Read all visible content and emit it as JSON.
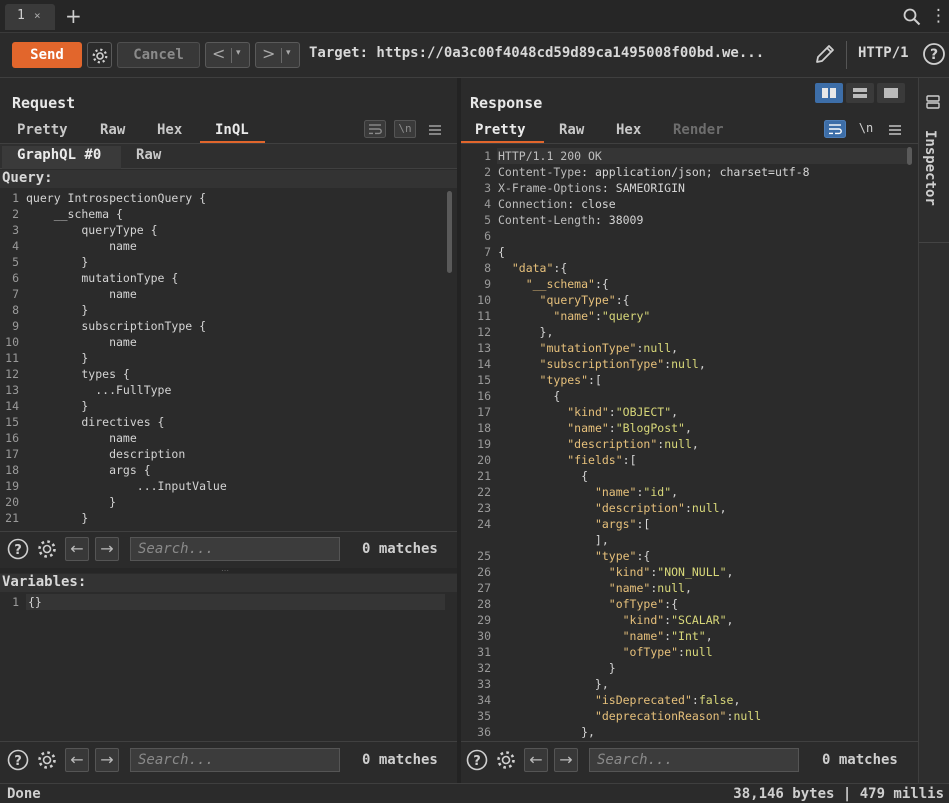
{
  "tabbar": {
    "tab_label": "1",
    "close": "×",
    "add": "+"
  },
  "toolbar": {
    "send_label": "Send",
    "cancel_label": "Cancel",
    "back_arrow": "<",
    "forward_arrow": ">",
    "dropdown": "▾",
    "target": "Target: https://0a3c00f4048cd59d89ca1495008f00bd.we...",
    "http_version": "HTTP/1"
  },
  "request": {
    "title": "Request",
    "tabs": [
      "Pretty",
      "Raw",
      "Hex",
      "InQL"
    ],
    "active_tab": "InQL",
    "inql_tabs": [
      "GraphQL #0",
      "Raw"
    ],
    "query_label": "Query:",
    "query_lines": [
      "query IntrospectionQuery {",
      "    __schema {",
      "        queryType {",
      "            name",
      "        }",
      "        mutationType {",
      "            name",
      "        }",
      "        subscriptionType {",
      "            name",
      "        }",
      "        types {",
      "          ...FullType",
      "        }",
      "        directives {",
      "            name",
      "            description",
      "            args {",
      "                ...InputValue",
      "            }",
      "        }"
    ],
    "variables_label": "Variables:",
    "variables_lines": [
      "{}"
    ],
    "search_placeholder": "Search...",
    "matches": "0 matches"
  },
  "response": {
    "title": "Response",
    "tabs": [
      "Pretty",
      "Raw",
      "Hex",
      "Render"
    ],
    "active_tab": "Pretty",
    "newline_toggle": "\\n",
    "lines": [
      [
        [
          "hd",
          "HTTP/1.1 200 OK"
        ]
      ],
      [
        [
          "hd",
          "Content-Type"
        ],
        [
          "tx",
          ": application/json; charset=utf-8"
        ]
      ],
      [
        [
          "hd",
          "X-Frame-Options"
        ],
        [
          "tx",
          ": SAMEORIGIN"
        ]
      ],
      [
        [
          "hd",
          "Connection"
        ],
        [
          "tx",
          ": close"
        ]
      ],
      [
        [
          "hd",
          "Content-Length"
        ],
        [
          "tx",
          ": 38009"
        ]
      ],
      [],
      [
        [
          "tx",
          "{"
        ]
      ],
      [
        [
          "tx",
          "  "
        ],
        [
          "k",
          "\"data\""
        ],
        [
          "tx",
          ":{"
        ]
      ],
      [
        [
          "tx",
          "    "
        ],
        [
          "k",
          "\"__schema\""
        ],
        [
          "tx",
          ":{"
        ]
      ],
      [
        [
          "tx",
          "      "
        ],
        [
          "k",
          "\"queryType\""
        ],
        [
          "tx",
          ":{"
        ]
      ],
      [
        [
          "tx",
          "        "
        ],
        [
          "k",
          "\"name\""
        ],
        [
          "tx",
          ":"
        ],
        [
          "s",
          "\"query\""
        ]
      ],
      [
        [
          "tx",
          "      },"
        ]
      ],
      [
        [
          "tx",
          "      "
        ],
        [
          "k",
          "\"mutationType\""
        ],
        [
          "tx",
          ":"
        ],
        [
          "s",
          "null"
        ],
        [
          "tx",
          ","
        ]
      ],
      [
        [
          "tx",
          "      "
        ],
        [
          "k",
          "\"subscriptionType\""
        ],
        [
          "tx",
          ":"
        ],
        [
          "s",
          "null"
        ],
        [
          "tx",
          ","
        ]
      ],
      [
        [
          "tx",
          "      "
        ],
        [
          "k",
          "\"types\""
        ],
        [
          "tx",
          ":["
        ]
      ],
      [
        [
          "tx",
          "        {"
        ]
      ],
      [
        [
          "tx",
          "          "
        ],
        [
          "k",
          "\"kind\""
        ],
        [
          "tx",
          ":"
        ],
        [
          "s",
          "\"OBJECT\""
        ],
        [
          "tx",
          ","
        ]
      ],
      [
        [
          "tx",
          "          "
        ],
        [
          "k",
          "\"name\""
        ],
        [
          "tx",
          ":"
        ],
        [
          "s",
          "\"BlogPost\""
        ],
        [
          "tx",
          ","
        ]
      ],
      [
        [
          "tx",
          "          "
        ],
        [
          "k",
          "\"description\""
        ],
        [
          "tx",
          ":"
        ],
        [
          "s",
          "null"
        ],
        [
          "tx",
          ","
        ]
      ],
      [
        [
          "tx",
          "          "
        ],
        [
          "k",
          "\"fields\""
        ],
        [
          "tx",
          ":["
        ]
      ],
      [
        [
          "tx",
          "            {"
        ]
      ],
      [
        [
          "tx",
          "              "
        ],
        [
          "k",
          "\"name\""
        ],
        [
          "tx",
          ":"
        ],
        [
          "s",
          "\"id\""
        ],
        [
          "tx",
          ","
        ]
      ],
      [
        [
          "tx",
          "              "
        ],
        [
          "k",
          "\"description\""
        ],
        [
          "tx",
          ":"
        ],
        [
          "s",
          "null"
        ],
        [
          "tx",
          ","
        ]
      ],
      [
        [
          "tx",
          "              "
        ],
        [
          "k",
          "\"args\""
        ],
        [
          "tx",
          ":["
        ]
      ],
      [
        [
          "tx",
          "              ],"
        ]
      ],
      [
        [
          "tx",
          "              "
        ],
        [
          "k",
          "\"type\""
        ],
        [
          "tx",
          ":{"
        ]
      ],
      [
        [
          "tx",
          "                "
        ],
        [
          "k",
          "\"kind\""
        ],
        [
          "tx",
          ":"
        ],
        [
          "s",
          "\"NON_NULL\""
        ],
        [
          "tx",
          ","
        ]
      ],
      [
        [
          "tx",
          "                "
        ],
        [
          "k",
          "\"name\""
        ],
        [
          "tx",
          ":"
        ],
        [
          "s",
          "null"
        ],
        [
          "tx",
          ","
        ]
      ],
      [
        [
          "tx",
          "                "
        ],
        [
          "k",
          "\"ofType\""
        ],
        [
          "tx",
          ":{"
        ]
      ],
      [
        [
          "tx",
          "                  "
        ],
        [
          "k",
          "\"kind\""
        ],
        [
          "tx",
          ":"
        ],
        [
          "s",
          "\"SCALAR\""
        ],
        [
          "tx",
          ","
        ]
      ],
      [
        [
          "tx",
          "                  "
        ],
        [
          "k",
          "\"name\""
        ],
        [
          "tx",
          ":"
        ],
        [
          "s",
          "\"Int\""
        ],
        [
          "tx",
          ","
        ]
      ],
      [
        [
          "tx",
          "                  "
        ],
        [
          "k",
          "\"ofType\""
        ],
        [
          "tx",
          ":"
        ],
        [
          "s",
          "null"
        ]
      ],
      [
        [
          "tx",
          "                }"
        ]
      ],
      [
        [
          "tx",
          "              },"
        ]
      ],
      [
        [
          "tx",
          "              "
        ],
        [
          "k",
          "\"isDeprecated\""
        ],
        [
          "tx",
          ":"
        ],
        [
          "s",
          "false"
        ],
        [
          "tx",
          ","
        ]
      ],
      [
        [
          "tx",
          "              "
        ],
        [
          "k",
          "\"deprecationReason\""
        ],
        [
          "tx",
          ":"
        ],
        [
          "s",
          "null"
        ]
      ],
      [
        [
          "tx",
          "            },"
        ]
      ]
    ],
    "line_numbers": [
      "1",
      "2",
      "3",
      "4",
      "5",
      "6",
      "7",
      "8",
      "9",
      "10",
      "11",
      "12",
      "13",
      "14",
      "15",
      "16",
      "17",
      "18",
      "19",
      "20",
      "21",
      "22",
      "23",
      "24",
      "",
      "25",
      "26",
      "27",
      "28",
      "29",
      "30",
      "31",
      "32",
      "33",
      "34",
      "35",
      "36"
    ],
    "search_placeholder": "Search...",
    "matches": "0 matches"
  },
  "inspector": {
    "label": "Inspector"
  },
  "status": {
    "left": "Done",
    "right": "38,146 bytes | 479 millis"
  },
  "colors": {
    "accent": "#e2662c",
    "key": "#e6c07b",
    "string": "#d8d87a",
    "bg": "#2b2b2b"
  }
}
